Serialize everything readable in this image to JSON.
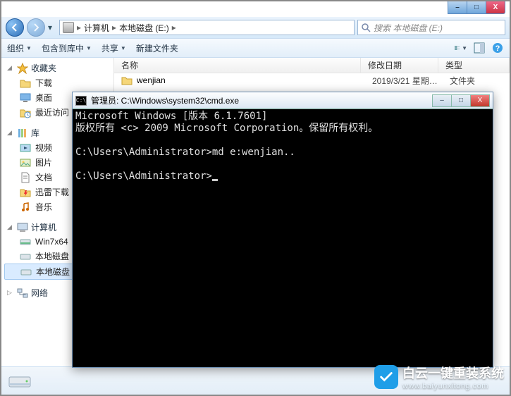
{
  "window": {
    "min": "–",
    "max": "□",
    "close": "X"
  },
  "nav": {
    "back": "◄",
    "forward": "►",
    "drop": "▾",
    "seg1": "计算机",
    "seg2": "本地磁盘 (E:)",
    "sep": "▸",
    "search_placeholder": "搜索 本地磁盘 (E:)"
  },
  "toolbar": {
    "organize": "组织",
    "include": "包含到库中",
    "share": "共享",
    "newfolder": "新建文件夹"
  },
  "sidebar": {
    "fav": "收藏夹",
    "fav_items": [
      "下载",
      "桌面",
      "最近访问"
    ],
    "lib": "库",
    "lib_items": [
      "视频",
      "图片",
      "文档",
      "迅雷下载",
      "音乐"
    ],
    "computer": "计算机",
    "comp_items": [
      "Win7x64",
      "本地磁盘",
      "本地磁盘"
    ],
    "network": "网络"
  },
  "columns": {
    "name": "名称",
    "date": "修改日期",
    "type": "类型"
  },
  "files": [
    {
      "name": "wenjian",
      "date": "2019/3/21 星期…",
      "type": "文件夹"
    }
  ],
  "cmd": {
    "title": "管理员: C:\\Windows\\system32\\cmd.exe",
    "line1": "Microsoft Windows [版本 6.1.7601]",
    "line2": "版权所有 <c> 2009 Microsoft Corporation。保留所有权利。",
    "line3": "C:\\Users\\Administrator>md e:wenjian..",
    "line4": "C:\\Users\\Administrator>"
  },
  "watermark": {
    "brand": "白云一键重装系统",
    "url": "www.baiyunxitong.com"
  }
}
